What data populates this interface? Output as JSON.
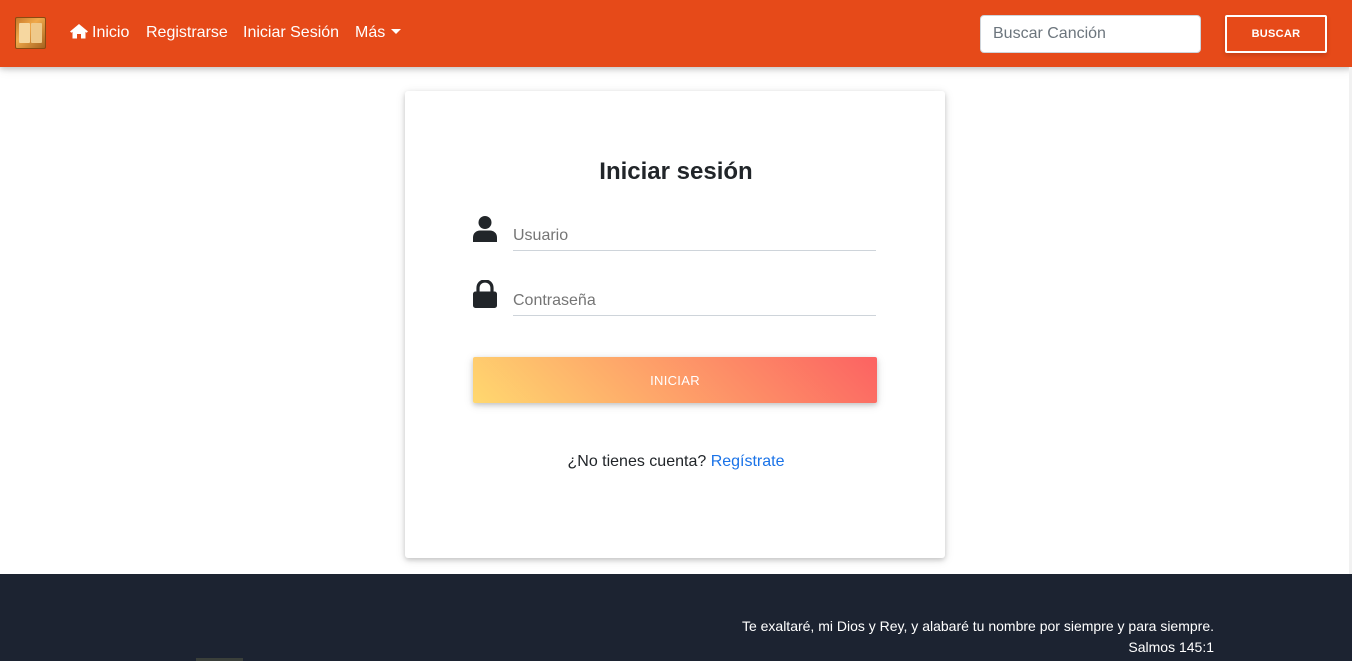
{
  "navbar": {
    "brand_icon": "songbook-logo",
    "home_label": "Inicio",
    "register_label": "Registrarse",
    "login_label": "Iniciar Sesión",
    "more_label": "Más",
    "search": {
      "placeholder": "Buscar Canción",
      "value": ""
    },
    "search_button_label": "BUSCAR",
    "color": "#e64a19"
  },
  "login_card": {
    "title": "Iniciar sesión",
    "username": {
      "icon": "user-icon",
      "placeholder": "Usuario",
      "value": ""
    },
    "password": {
      "icon": "lock-icon",
      "placeholder": "Contraseña",
      "value": ""
    },
    "submit_label": "INICIAR",
    "submit_gradient": [
      "#ffd86f",
      "#fc6262"
    ],
    "no_account_text": "¿No tienes cuenta?",
    "register_link": "Regístrate"
  },
  "footer": {
    "verse": "Te exaltaré, mi Dios y Rey, y alabaré tu nombre por siempre y para siempre.",
    "reference": "Salmos 145:1",
    "color": "#1c2331"
  }
}
